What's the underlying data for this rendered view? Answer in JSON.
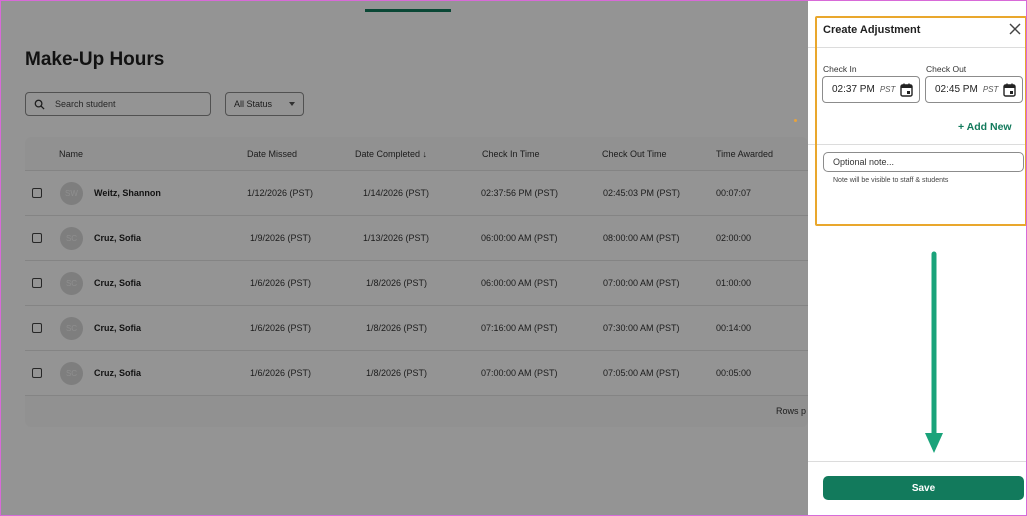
{
  "page": {
    "title": "Make-Up Hours",
    "search_placeholder": "Search student",
    "status_filter": "All Status"
  },
  "table": {
    "columns": [
      "Name",
      "Date Missed",
      "Date Completed ↓",
      "Check In Time",
      "Check Out Time",
      "Time Awarded"
    ],
    "rows": [
      {
        "initials": "SW",
        "name": "Weitz, Shannon",
        "date_missed": "1/12/2026 (PST)",
        "date_completed": "1/14/2026 (PST)",
        "check_in": "02:37:56 PM (PST)",
        "check_out": "02:45:03 PM (PST)",
        "time_awarded": "00:07:07"
      },
      {
        "initials": "SC",
        "name": "Cruz, Sofia",
        "date_missed": "1/9/2026 (PST)",
        "date_completed": "1/13/2026 (PST)",
        "check_in": "06:00:00 AM (PST)",
        "check_out": "08:00:00 AM (PST)",
        "time_awarded": "02:00:00"
      },
      {
        "initials": "SC",
        "name": "Cruz, Sofia",
        "date_missed": "1/6/2026 (PST)",
        "date_completed": "1/8/2026 (PST)",
        "check_in": "06:00:00 AM (PST)",
        "check_out": "07:00:00 AM (PST)",
        "time_awarded": "01:00:00"
      },
      {
        "initials": "SC",
        "name": "Cruz, Sofia",
        "date_missed": "1/6/2026 (PST)",
        "date_completed": "1/8/2026 (PST)",
        "check_in": "07:16:00 AM (PST)",
        "check_out": "07:30:00 AM (PST)",
        "time_awarded": "00:14:00"
      },
      {
        "initials": "SC",
        "name": "Cruz, Sofia",
        "date_missed": "1/6/2026 (PST)",
        "date_completed": "1/8/2026 (PST)",
        "check_in": "07:00:00 AM (PST)",
        "check_out": "07:05:00 AM (PST)",
        "time_awarded": "00:05:00"
      }
    ],
    "rows_per_page_label": "Rows p"
  },
  "drawer": {
    "title": "Create Adjustment",
    "check_in_label": "Check In",
    "check_in_value": "02:37 PM",
    "check_in_tz": "PST",
    "check_out_label": "Check Out",
    "check_out_value": "02:45 PM",
    "check_out_tz": "PST",
    "add_new": "+ Add New",
    "note_placeholder": "Optional note...",
    "note_hint": "Note will be visible to staff & students",
    "save": "Save"
  },
  "colors": {
    "brand": "#127a5c",
    "highlight": "#e9a72d",
    "arrow": "#1aa37a"
  }
}
